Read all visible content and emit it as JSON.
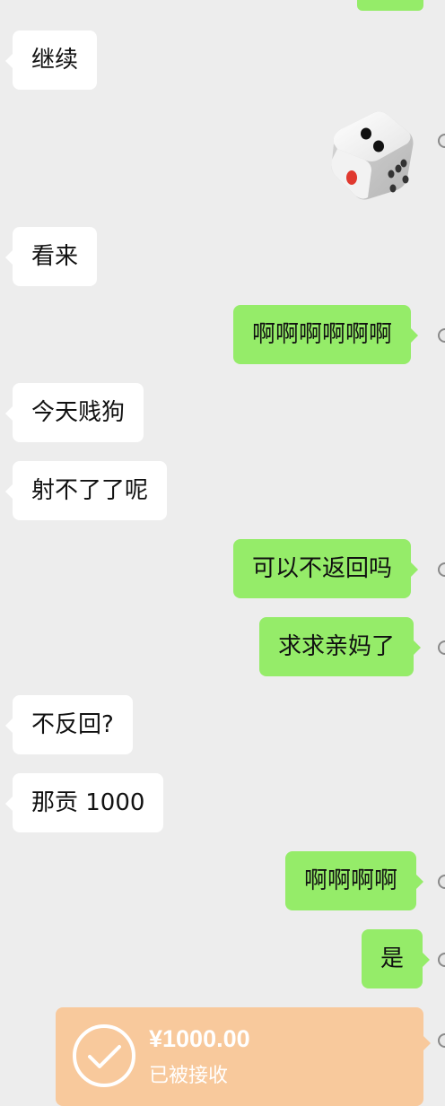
{
  "messages": {
    "m1": "继续",
    "m2": "看来",
    "m3": "啊啊啊啊啊啊",
    "m4": "今天贱狗",
    "m5": "射不了了呢",
    "m6": "可以不返回吗",
    "m7": "求求亲妈了",
    "m8": "不反回?",
    "m9": "那贡 1000",
    "m10": "啊啊啊啊",
    "m11": "是"
  },
  "dice": {
    "icon": "dice-icon",
    "face_value": 2
  },
  "transfer": {
    "amount": "¥1000.00",
    "status": "已被接收",
    "icon": "check-circle-icon"
  },
  "colors": {
    "background": "#ededed",
    "incoming_bubble": "#ffffff",
    "outgoing_bubble": "#95ec69",
    "transfer_card": "#f8c99c"
  }
}
